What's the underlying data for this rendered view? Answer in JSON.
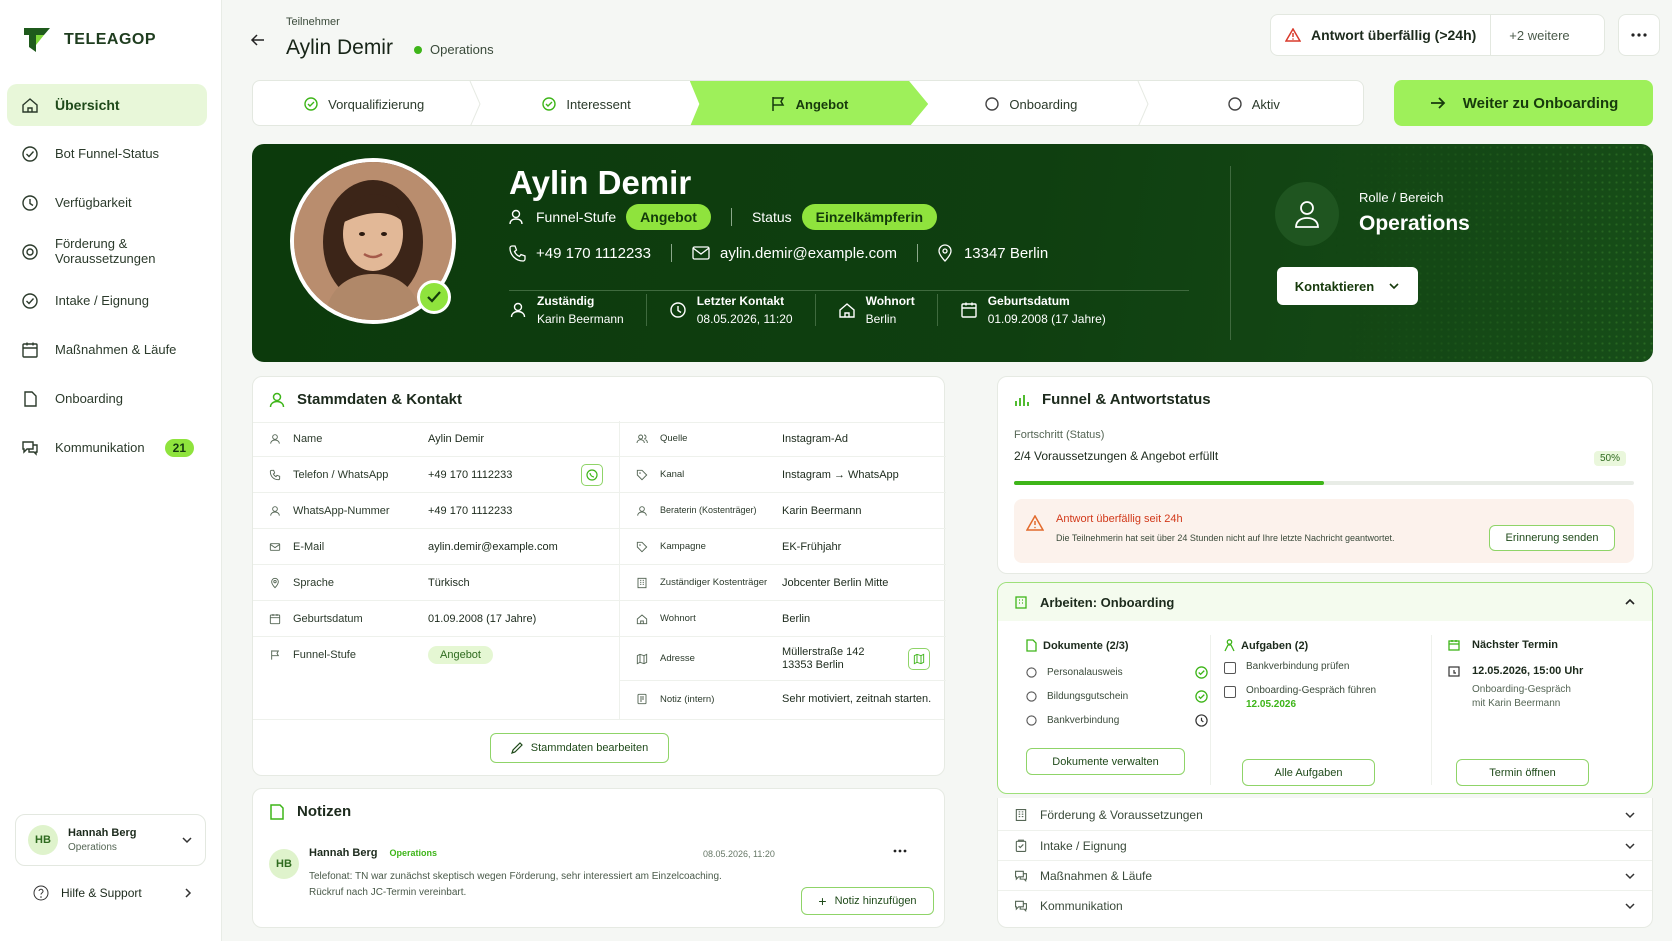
{
  "brand": {
    "name": "TELEAGOP",
    "accent": "#9ef05a",
    "dark": "#0f3f10"
  },
  "sidebar": {
    "items": [
      {
        "label": "Übersicht",
        "icon": "home-icon",
        "active": true
      },
      {
        "label": "Bot Funnel-Status",
        "icon": "check-circle-icon"
      },
      {
        "label": "Verfügbarkeit",
        "icon": "clock-icon"
      },
      {
        "label": "Förderung & Voraussetzungen",
        "icon": "target-icon"
      },
      {
        "label": "Intake / Eignung",
        "icon": "check-circle-icon"
      },
      {
        "label": "Maßnahmen & Läufe",
        "icon": "calendar-icon"
      },
      {
        "label": "Onboarding",
        "icon": "document-icon"
      },
      {
        "label": "Kommunikation",
        "icon": "chat-icon",
        "badge": "21"
      }
    ],
    "user": {
      "initials": "HB",
      "name": "Hannah Berg",
      "role": "Operations"
    },
    "help": "Hilfe & Support"
  },
  "header": {
    "subtitle": "Teilnehmer",
    "name": "Aylin Demir",
    "team": "Operations",
    "alert": "Antwort überfällig (>24h)",
    "more_alerts": "+2 weitere"
  },
  "stepper": {
    "steps": [
      {
        "label": "Vorqualifizierung",
        "state": "done"
      },
      {
        "label": "Interessent",
        "state": "done"
      },
      {
        "label": "Angebot",
        "state": "active"
      },
      {
        "label": "Onboarding",
        "state": "todo"
      },
      {
        "label": "Aktiv",
        "state": "todo"
      }
    ],
    "cta": "Weiter zu Onboarding"
  },
  "hero": {
    "name": "Aylin Demir",
    "funnel_label": "Funnel-Stufe",
    "funnel_value": "Angebot",
    "status_label": "Status",
    "status_value": "Einzelkämpferin",
    "phone": "+49 170 1112233",
    "email": "aylin.demir@example.com",
    "location": "13347 Berlin",
    "meta": [
      {
        "label": "Zuständig",
        "value": "Karin Beermann",
        "icon": "user-icon"
      },
      {
        "label": "Letzter Kontakt",
        "value": "08.05.2026, 11:20",
        "icon": "clock-icon"
      },
      {
        "label": "Wohnort",
        "value": "Berlin",
        "icon": "home-icon"
      },
      {
        "label": "Geburtsdatum",
        "value": "01.09.2008 (17 Jahre)",
        "icon": "calendar-icon"
      }
    ],
    "role_label": "Rolle / Bereich",
    "role_value": "Operations",
    "contact_btn": "Kontaktieren"
  },
  "stammdaten": {
    "title": "Stammdaten & Kontakt",
    "left": [
      {
        "k": "Name",
        "v": "Aylin Demir",
        "icon": "user-icon"
      },
      {
        "k": "Telefon / WhatsApp",
        "v": "+49 170 1112233",
        "icon": "phone-icon"
      },
      {
        "k": "WhatsApp-Nummer",
        "v": "+49 170 1112233",
        "icon": "user-icon"
      },
      {
        "k": "E-Mail",
        "v": "aylin.demir@example.com",
        "icon": "mail-icon"
      },
      {
        "k": "Sprache",
        "v": "Türkisch",
        "icon": "pin-icon"
      },
      {
        "k": "Geburtsdatum",
        "v": "01.09.2008 (17 Jahre)",
        "icon": "calendar-icon"
      },
      {
        "k": "Funnel-Stufe",
        "v": "Angebot",
        "icon": "flag-icon"
      }
    ],
    "right": [
      {
        "k": "Quelle",
        "v": "Instagram-Ad",
        "icon": "users-icon"
      },
      {
        "k": "Kanal",
        "v": "Instagram → WhatsApp",
        "icon": "tag-icon"
      },
      {
        "k": "Beraterin (Kostenträger)",
        "v": "Karin Beermann",
        "icon": "user-icon"
      },
      {
        "k": "Kampagne",
        "v": "EK-Frühjahr",
        "icon": "tag-icon"
      },
      {
        "k": "Zuständiger Kostenträger",
        "v": "Jobcenter Berlin Mitte",
        "icon": "building-icon"
      },
      {
        "k": "Wohnort",
        "v": "Berlin",
        "icon": "home-icon"
      },
      {
        "k": "Adresse",
        "v": "Müllerstraße 142",
        "v2": "13353 Berlin",
        "icon": "map-icon"
      },
      {
        "k": "Notiz (intern)",
        "v": "Sehr motiviert, zeitnah starten.",
        "icon": "note-icon"
      }
    ],
    "edit_btn": "Stammdaten bearbeiten"
  },
  "notizen": {
    "title": "Notizen",
    "author": "Hannah Berg",
    "initials": "HB",
    "team": "Operations",
    "date": "08.05.2026, 11:20",
    "text1": "Telefonat: TN war zunächst skeptisch wegen Förderung, sehr interessiert am Einzelcoaching.",
    "text2": "Rückruf nach JC-Termin vereinbart.",
    "add_btn": "Notiz hinzufügen"
  },
  "funnel": {
    "title": "Funnel & Antwortstatus",
    "progress_label": "Fortschritt (Status)",
    "progress_text": "2/4 Voraussetzungen & Angebot erfüllt",
    "progress_pct": "50%",
    "progress_value": 0.5,
    "warn_title": "Antwort überfällig seit 24h",
    "warn_text": "Die Teilnehmerin hat seit über 24 Stunden nicht auf Ihre letzte Nachricht geantwortet.",
    "warn_btn": "Erinnerung senden"
  },
  "arbeiten": {
    "title": "Arbeiten: Onboarding",
    "docs_title": "Dokumente (2/3)",
    "docs": [
      {
        "label": "Personalausweis",
        "state": "done"
      },
      {
        "label": "Bildungsgutschein",
        "state": "done"
      },
      {
        "label": "Bankverbindung",
        "state": "pending"
      }
    ],
    "docs_btn": "Dokumente verwalten",
    "tasks_title": "Aufgaben (2)",
    "tasks": [
      {
        "label": "Bankverbindung prüfen"
      },
      {
        "label": "Onboarding-Gespräch führen",
        "date": "12.05.2026"
      }
    ],
    "tasks_btn": "Alle Aufgaben",
    "termin_title": "Nächster Termin",
    "termin_date": "12.05.2026, 15:00 Uhr",
    "termin_desc1": "Onboarding-Gespräch",
    "termin_desc2": "mit Karin Beermann",
    "termin_btn": "Termin öffnen"
  },
  "accordion": [
    {
      "label": "Förderung & Voraussetzungen",
      "icon": "building-icon"
    },
    {
      "label": "Intake / Eignung",
      "icon": "clipboard-icon"
    },
    {
      "label": "Maßnahmen & Läufe",
      "icon": "chat-icon"
    },
    {
      "label": "Kommunikation",
      "icon": "chat-icon"
    }
  ]
}
